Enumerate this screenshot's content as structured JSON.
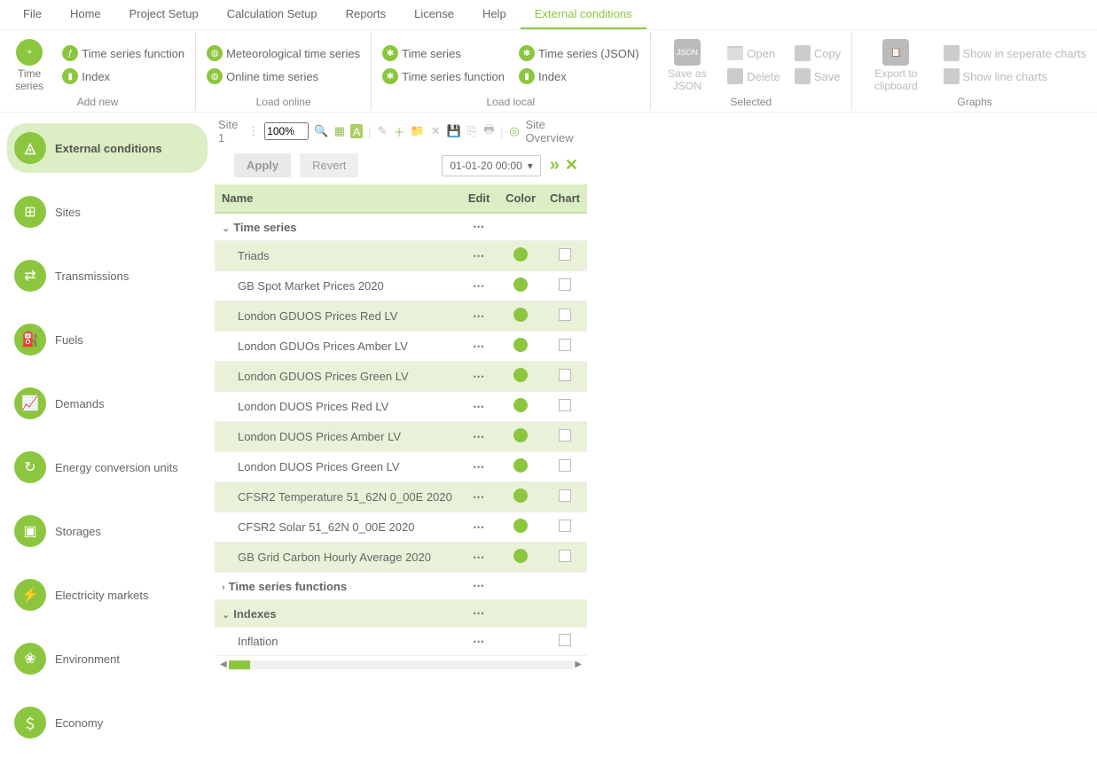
{
  "menu": {
    "items": [
      "File",
      "Home",
      "Project Setup",
      "Calculation Setup",
      "Reports",
      "License",
      "Help",
      "External conditions"
    ],
    "active_index": 7
  },
  "ribbon": {
    "groups": [
      {
        "label": "Add new",
        "big": [
          {
            "label": "Time series",
            "icon": "plus-chart"
          }
        ],
        "col": [
          {
            "label": "Time series function",
            "icon": "func"
          },
          {
            "label": "Index",
            "icon": "bars"
          }
        ]
      },
      {
        "label": "Load online",
        "col": [
          {
            "label": "Meteorological time series",
            "icon": "globe"
          },
          {
            "label": "Online time series",
            "icon": "globe"
          }
        ]
      },
      {
        "label": "Load local",
        "cols": [
          [
            {
              "label": "Time series",
              "icon": "gear"
            },
            {
              "label": "Time series function",
              "icon": "gear"
            }
          ],
          [
            {
              "label": "Time series (JSON)",
              "icon": "gear"
            },
            {
              "label": "Index",
              "icon": "bars"
            }
          ]
        ]
      },
      {
        "label": "Selected",
        "big": [
          {
            "label": "Save as JSON",
            "icon": "json",
            "disabled": true
          }
        ],
        "cols": [
          [
            {
              "label": "Open",
              "icon": "open",
              "disabled": true
            },
            {
              "label": "Delete",
              "icon": "delete",
              "disabled": true
            }
          ],
          [
            {
              "label": "Copy",
              "icon": "copy",
              "disabled": true
            },
            {
              "label": "Save",
              "icon": "save",
              "disabled": true
            }
          ]
        ]
      },
      {
        "label": "Graphs",
        "big": [
          {
            "label": "Export to clipboard",
            "icon": "clipboard",
            "disabled": true
          }
        ],
        "col": [
          {
            "label": "Show in seperate charts",
            "icon": "chart",
            "disabled": true
          },
          {
            "label": "Show line charts",
            "icon": "chart",
            "disabled": true
          }
        ]
      }
    ]
  },
  "sidebar": {
    "items": [
      {
        "label": "External conditions",
        "active": true
      },
      {
        "label": "Sites"
      },
      {
        "label": "Transmissions"
      },
      {
        "label": "Fuels"
      },
      {
        "label": "Demands"
      },
      {
        "label": "Energy conversion units"
      },
      {
        "label": "Storages"
      },
      {
        "label": "Electricity markets"
      },
      {
        "label": "Environment"
      },
      {
        "label": "Economy"
      }
    ]
  },
  "mini_toolbar": {
    "site_label": "Site 1",
    "zoom": "100%",
    "overview_label": "Site Overview"
  },
  "controls": {
    "apply": "Apply",
    "revert": "Revert",
    "date": "01-01-20 00:00"
  },
  "table": {
    "headers": {
      "name": "Name",
      "edit": "Edit",
      "color": "Color",
      "chart": "Chart"
    },
    "groups": [
      {
        "label": "Time series",
        "expanded": true,
        "rows": [
          {
            "name": "Triads",
            "alt": true,
            "color": true,
            "chart": false
          },
          {
            "name": "GB Spot Market Prices 2020",
            "alt": false,
            "color": true,
            "chart": false
          },
          {
            "name": "London GDUOS Prices Red LV",
            "alt": true,
            "color": true,
            "chart": false
          },
          {
            "name": "London GDUOs Prices Amber LV",
            "alt": false,
            "color": true,
            "chart": false
          },
          {
            "name": "London GDUOS Prices Green LV",
            "alt": true,
            "color": true,
            "chart": false
          },
          {
            "name": "London DUOS Prices Red LV",
            "alt": false,
            "color": true,
            "chart": false
          },
          {
            "name": "London DUOS Prices Amber LV",
            "alt": true,
            "color": true,
            "chart": false
          },
          {
            "name": "London DUOS Prices Green LV",
            "alt": false,
            "color": true,
            "chart": false
          },
          {
            "name": "CFSR2 Temperature 51_62N 0_00E 2020",
            "alt": true,
            "color": true,
            "chart": false
          },
          {
            "name": "CFSR2 Solar 51_62N 0_00E 2020",
            "alt": false,
            "color": true,
            "chart": false
          },
          {
            "name": "GB Grid Carbon Hourly Average 2020",
            "alt": true,
            "color": true,
            "chart": false
          }
        ]
      },
      {
        "label": "Time series functions",
        "expanded": false,
        "rows": []
      },
      {
        "label": "Indexes",
        "expanded": true,
        "highlighted": true,
        "rows": [
          {
            "name": "Inflation",
            "alt": false,
            "color": false,
            "chart": false
          }
        ]
      }
    ]
  }
}
